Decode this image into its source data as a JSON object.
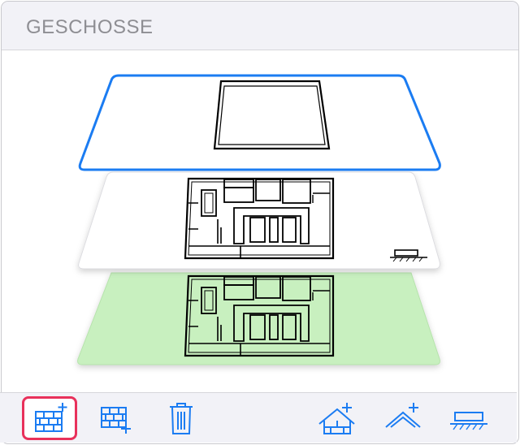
{
  "panel": {
    "title": "GESCHOSSE"
  },
  "floors": [
    {
      "name": "floor-top",
      "state": "selected",
      "fill": "#ffffff",
      "border": "#1b7cf2"
    },
    {
      "name": "floor-middle",
      "state": "normal",
      "fill": "#ffffff",
      "marker": "ground-level-icon"
    },
    {
      "name": "floor-bottom",
      "state": "normal",
      "fill": "#c8f0bf"
    }
  ],
  "toolbar": {
    "items": [
      {
        "name": "add-storey-above-icon",
        "selected": true
      },
      {
        "name": "add-storey-below-icon",
        "selected": false
      },
      {
        "name": "trash-icon",
        "selected": false
      },
      {
        "name": "add-roof-storey-icon",
        "selected": false
      },
      {
        "name": "add-roof-icon",
        "selected": false
      },
      {
        "name": "foundation-icon",
        "selected": false
      }
    ]
  },
  "colors": {
    "accent": "#1b7cf2",
    "selection": "#e8315b",
    "ground_floor": "#c8f0bf"
  }
}
